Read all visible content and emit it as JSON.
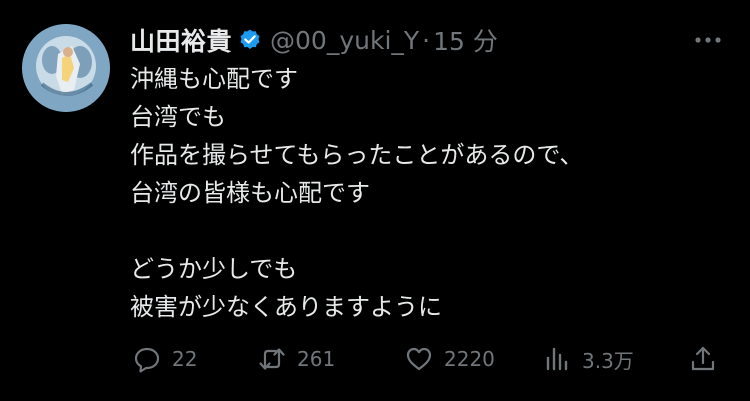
{
  "user": {
    "display_name": "山田裕貴",
    "handle": "@00_yuki_Y",
    "separator": "·",
    "time": "15 分",
    "verified": true
  },
  "tweet": {
    "lines": [
      "沖縄も心配です",
      "台湾でも",
      "作品を撮らせてもらったことがあるので、",
      "台湾の皆様も心配です",
      "",
      "どうか少しでも",
      "被害が少なくありますように"
    ]
  },
  "actions": {
    "reply_count": "22",
    "retweet_count": "261",
    "like_count": "2220",
    "views_count": "3.3万"
  },
  "colors": {
    "background": "#000000",
    "text_primary": "#e7e9ea",
    "text_secondary": "#71767b",
    "verified_badge": "#1d9bf0"
  },
  "icons": [
    "more-icon",
    "reply-icon",
    "retweet-icon",
    "like-icon",
    "views-icon",
    "share-icon",
    "verified-badge-icon"
  ]
}
